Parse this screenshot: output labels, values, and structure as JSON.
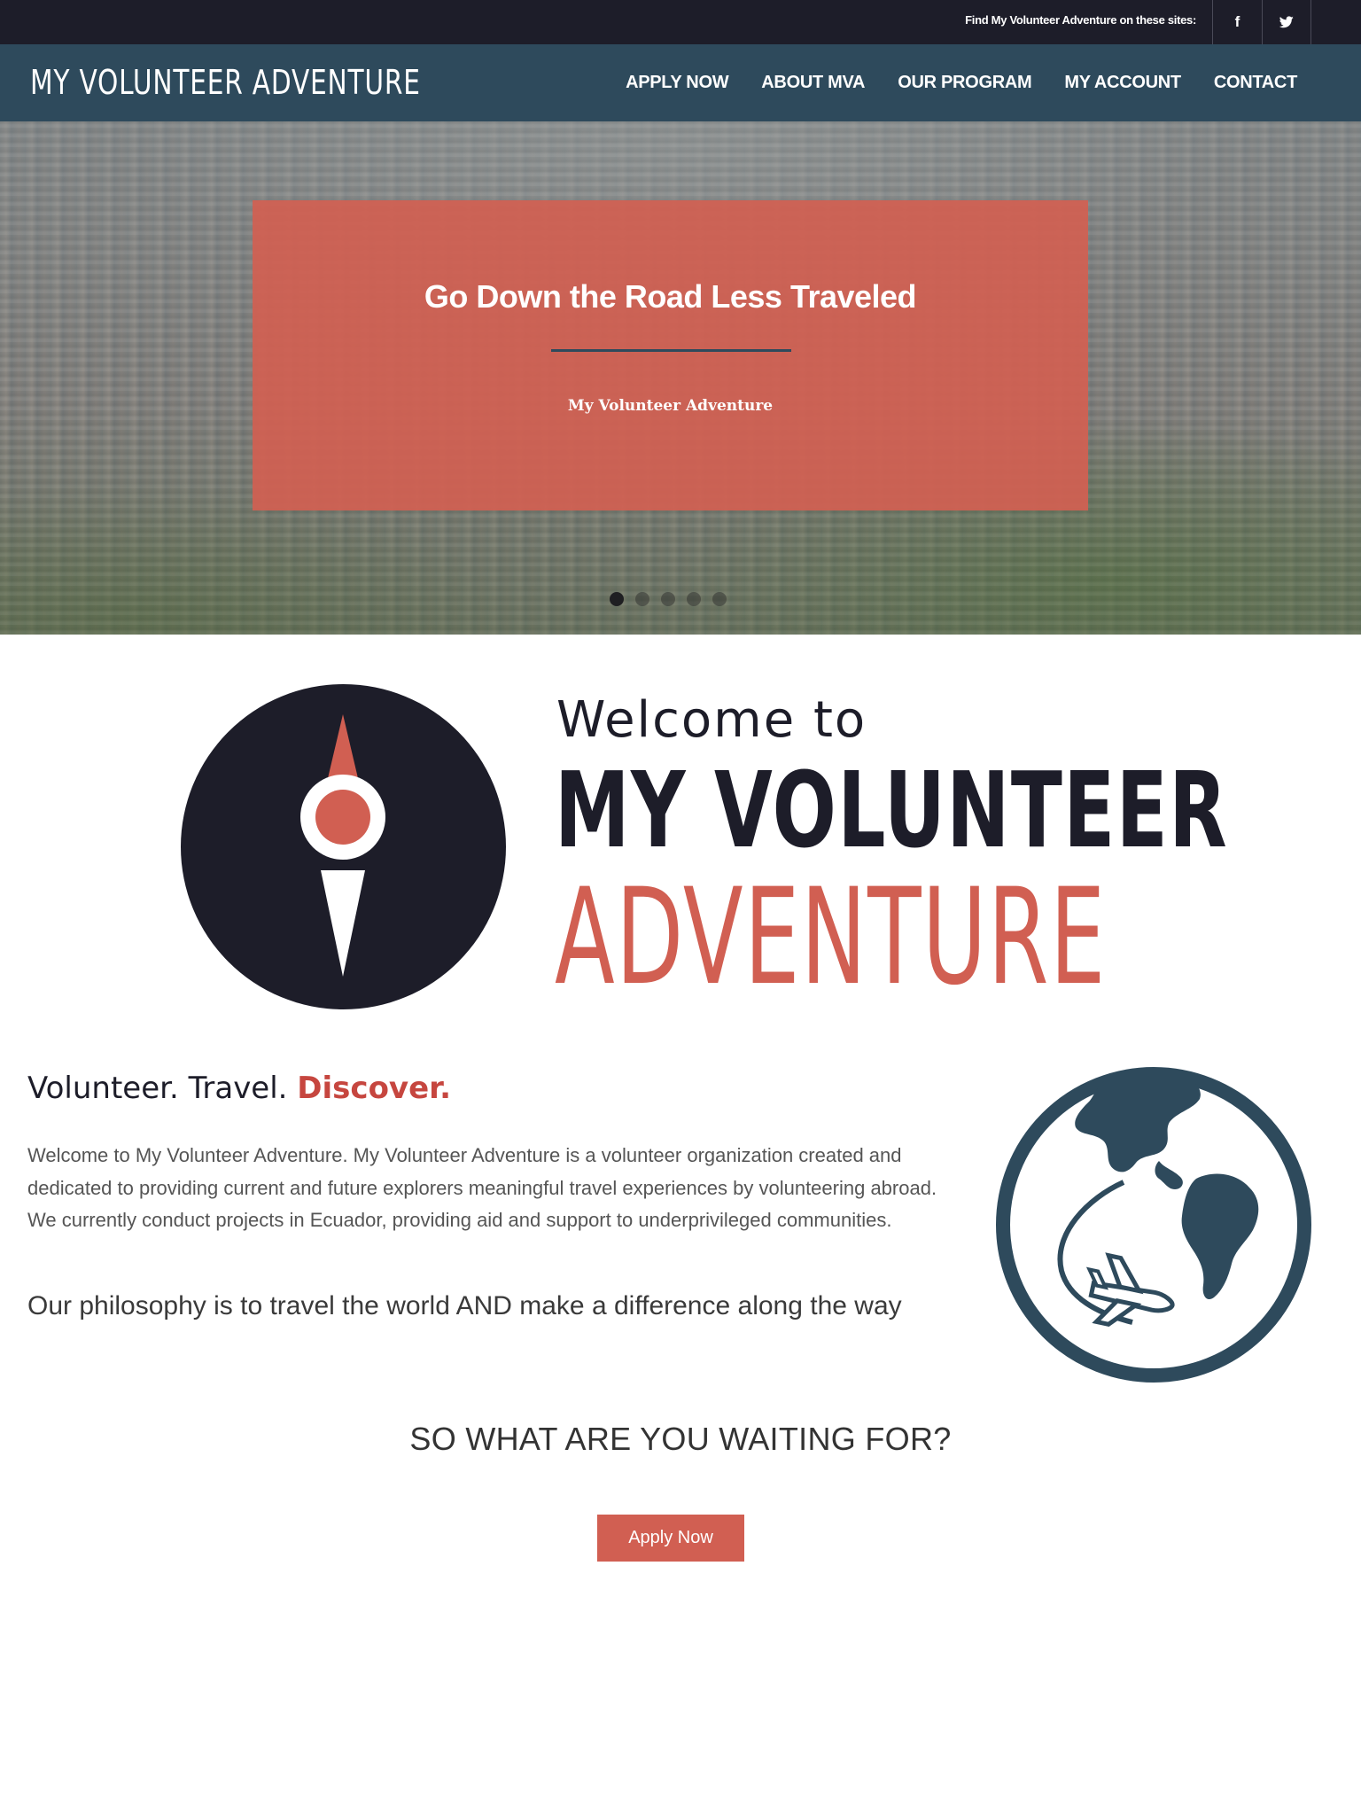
{
  "topbar": {
    "find_text": "Find My Volunteer Adventure on these sites:",
    "social": [
      {
        "name": "facebook",
        "glyph": "f"
      },
      {
        "name": "twitter",
        "glyph": "twitter-bird"
      }
    ]
  },
  "header": {
    "brand": "MY VOLUNTEER ADVENTURE",
    "nav": [
      "APPLY NOW",
      "ABOUT MVA",
      "OUR PROGRAM",
      "MY ACCOUNT",
      "CONTACT"
    ]
  },
  "hero": {
    "title": "Go Down the Road Less Traveled",
    "subtitle": "My Volunteer Adventure",
    "slide_count": 5,
    "active_slide": 1
  },
  "logo": {
    "line1": "Welcome to",
    "line2": "MY VOLUNTEER",
    "line3": "ADVENTURE"
  },
  "intro": {
    "tagline_part1": "Volunteer. Travel. ",
    "tagline_accent": "Discover.",
    "paragraph": "Welcome to My Volunteer Adventure. My Volunteer Adventure is a volunteer organization created and dedicated to providing current and future explorers meaningful travel experiences by volunteering abroad. We currently conduct projects in Ecuador, providing aid and support to underprivileged communities.",
    "philosophy": "Our philosophy is to travel the world AND make a difference along the way"
  },
  "cta": {
    "heading": "SO WHAT ARE YOU WAITING FOR?",
    "button": "Apply Now"
  },
  "colors": {
    "dark": "#1d1d29",
    "navy": "#2e4a5c",
    "coral": "#d15f52",
    "accent_red": "#c6463f"
  }
}
